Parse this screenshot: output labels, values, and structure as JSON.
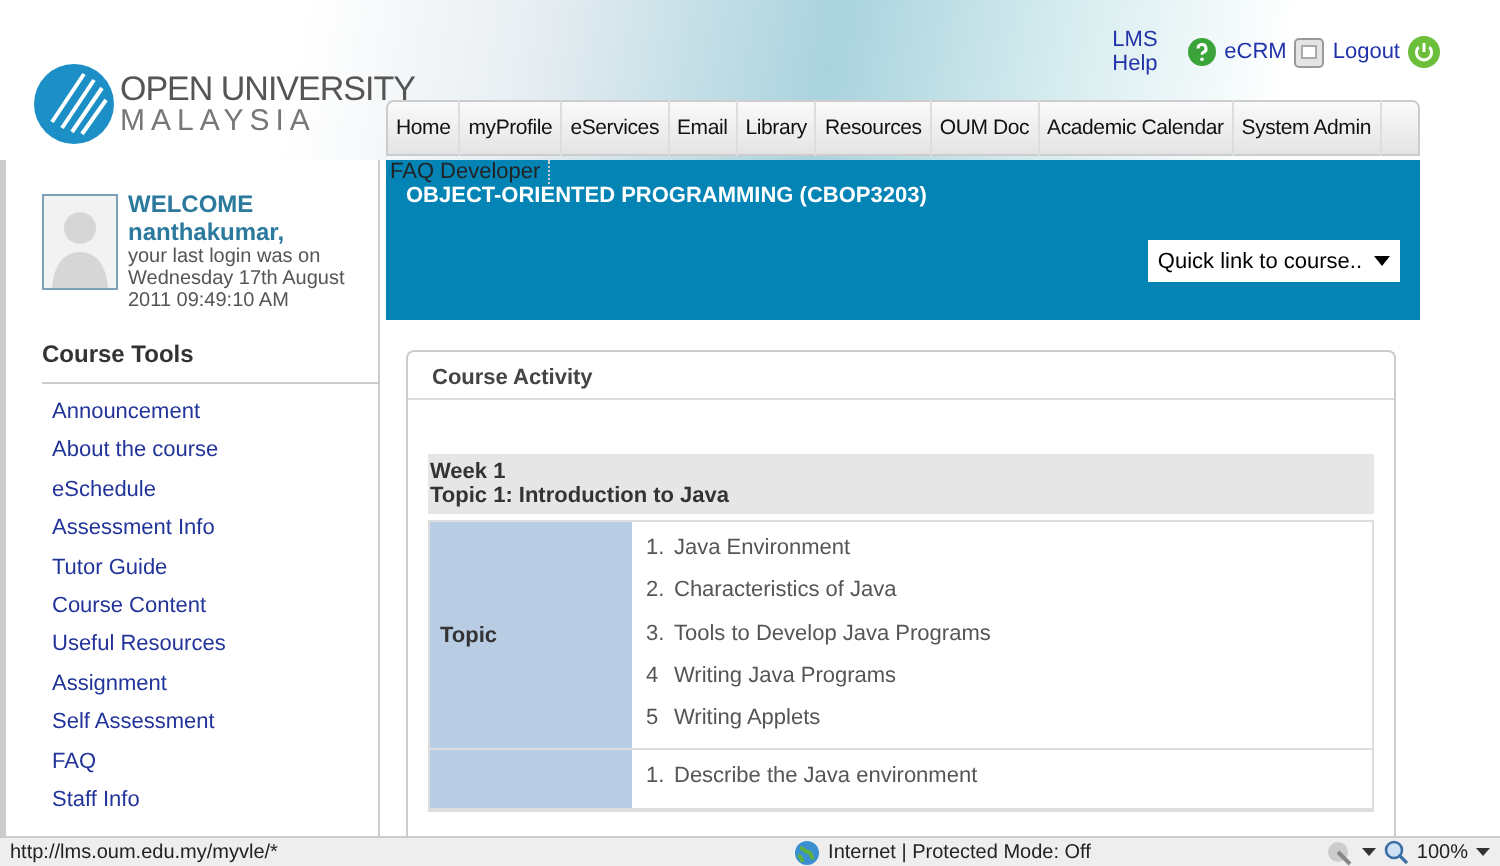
{
  "logo": {
    "name": "OPEN UNIVERSITY",
    "subtitle": "MALAYSIA"
  },
  "top_links": [
    "LMS Help",
    "eCRM",
    "Logout"
  ],
  "nav_tabs": [
    "Home",
    "myProfile",
    "eServices",
    "Email",
    "Library",
    "Resources",
    "OUM Doc",
    "Academic Calendar",
    "System Admin"
  ],
  "welcome": {
    "heading": "WELCOME",
    "user": "nanthakumar,",
    "last_login": "your last login was on Wednesday 17th August 2011 09:49:10 AM"
  },
  "sidebar": {
    "title": "Course Tools",
    "items": [
      "Announcement",
      "About the course",
      "eSchedule",
      "Assessment Info",
      "Tutor Guide",
      "Course Content",
      "Useful Resources",
      "Assignment",
      "Self Assessment",
      "FAQ",
      "Staff Info"
    ]
  },
  "banner": {
    "menu_text": "FAQ Developer",
    "course_title": "OBJECT-ORIENTED PROGRAMMING (CBOP3203)",
    "quick_link": "Quick link to course.."
  },
  "course_activity": {
    "title": "Course Activity",
    "week": "Week 1",
    "topic": "Topic 1: Introduction to Java",
    "rows": [
      {
        "label": "Topic",
        "items": [
          {
            "number": "1.",
            "text": "Java Environment"
          },
          {
            "number": "2.",
            "text": "Characteristics of Java"
          },
          {
            "number": "3.",
            "text": "Tools to Develop Java Programs"
          },
          {
            "number": "4",
            "text": "Writing Java Programs"
          },
          {
            "number": "5",
            "text": "Writing Applets"
          }
        ]
      },
      {
        "items": [
          {
            "number": "1.",
            "text": "Describe the Java environment"
          }
        ]
      }
    ]
  },
  "status_bar": {
    "url": "http://lms.oum.edu.my/myvle/*",
    "zone": "Internet | Protected Mode: Off",
    "zoom": "100%"
  }
}
